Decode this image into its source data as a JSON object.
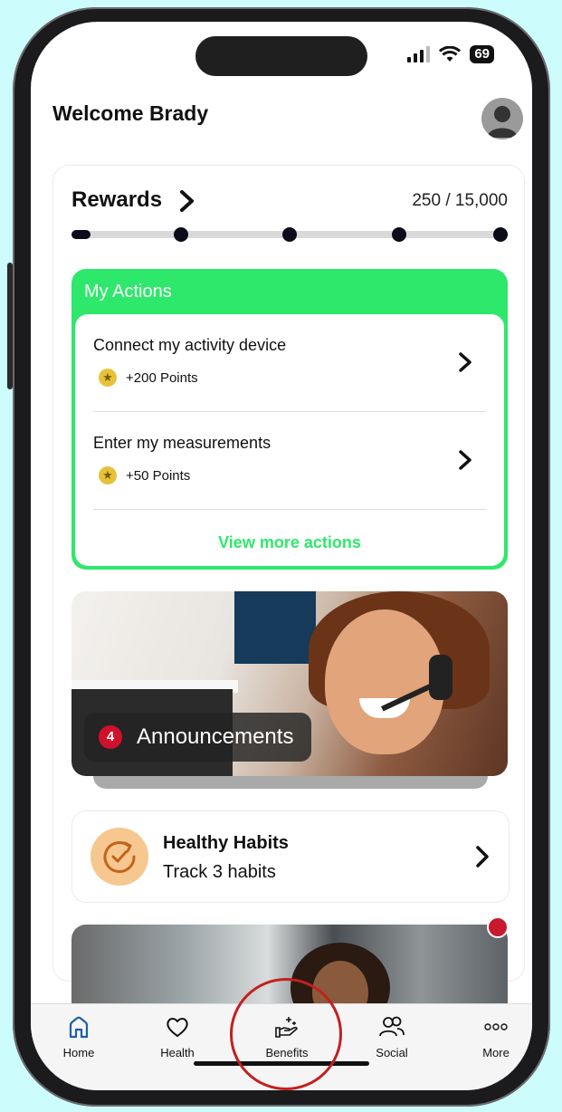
{
  "status": {
    "battery": "69"
  },
  "header": {
    "welcome": "Welcome Brady"
  },
  "rewards": {
    "title": "Rewards",
    "points_text": "250 / 15,000",
    "current": 250,
    "goal": 15000,
    "milestones": 4
  },
  "actions": {
    "title": "My Actions",
    "items": [
      {
        "label": "Connect my activity device",
        "points": "+200 Points"
      },
      {
        "label": "Enter my measurements",
        "points": "+50 Points"
      }
    ],
    "view_more": "View more actions"
  },
  "announcements": {
    "count": "4",
    "label": "Announcements"
  },
  "habits": {
    "title": "Healthy Habits",
    "subtitle": "Track 3 habits"
  },
  "tabs": [
    {
      "label": "Home",
      "icon": "home-icon"
    },
    {
      "label": "Health",
      "icon": "heart-icon"
    },
    {
      "label": "Benefits",
      "icon": "hand-sparkle-icon"
    },
    {
      "label": "Social",
      "icon": "people-icon"
    },
    {
      "label": "More",
      "icon": "more-dots-icon"
    }
  ],
  "colors": {
    "accent_green": "#2ee86b",
    "badge_red": "#d0112b",
    "home_tab": "#1d5fa8",
    "highlight_ring": "#c41f1f",
    "background": "#ccfcfb"
  }
}
